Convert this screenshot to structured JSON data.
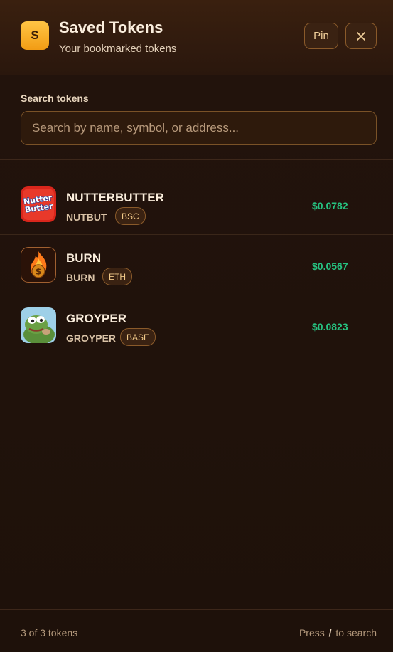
{
  "header": {
    "logo_text": "S",
    "title": "Saved Tokens",
    "subtitle": "Your bookmarked tokens",
    "pin_label": "Pin",
    "close_icon": "close-icon"
  },
  "search": {
    "label": "Search tokens",
    "placeholder": "Search by name, symbol, or address...",
    "value": ""
  },
  "tokens": [
    {
      "name": "NUTTERBUTTER",
      "symbol": "NUTBUT",
      "chain": "BSC",
      "price": "$0.0782",
      "logo_lines": [
        "Nutter",
        "Butter"
      ]
    },
    {
      "name": "BURN",
      "symbol": "BURN",
      "chain": "ETH",
      "price": "$0.0567",
      "logo_text": "$"
    },
    {
      "name": "GROYPER",
      "symbol": "GROYPER",
      "chain": "BASE",
      "price": "$0.0823"
    }
  ],
  "footer": {
    "count": "3 of 3 tokens",
    "hint_prefix": "Press",
    "hint_key": "/",
    "hint_suffix": "to search"
  },
  "colors": {
    "accent": "#f29c14",
    "price": "#26c281",
    "background": "#1f120b"
  }
}
